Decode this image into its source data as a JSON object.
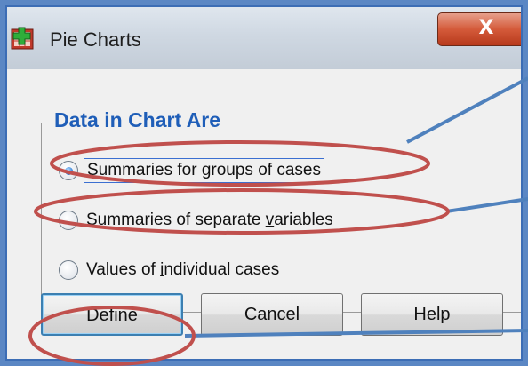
{
  "window": {
    "title": "Pie Charts",
    "close_label": "X",
    "icon": "spss-chart-icon"
  },
  "group": {
    "legend": "Data in Chart Are",
    "options": [
      {
        "label_pre": "Summaries for ",
        "mnemonic": "g",
        "label_post": "roups of cases",
        "selected": true
      },
      {
        "label_pre": "Summaries of separate ",
        "mnemonic": "v",
        "label_post": "ariables",
        "selected": false
      },
      {
        "label_pre": "Values of ",
        "mnemonic": "i",
        "label_post": "ndividual cases",
        "selected": false
      }
    ]
  },
  "buttons": {
    "define": "Define",
    "cancel": "Cancel",
    "help": "Help"
  },
  "annotations": {
    "highlight_color": "#c0504d",
    "callout_color": "#4f81bd"
  }
}
